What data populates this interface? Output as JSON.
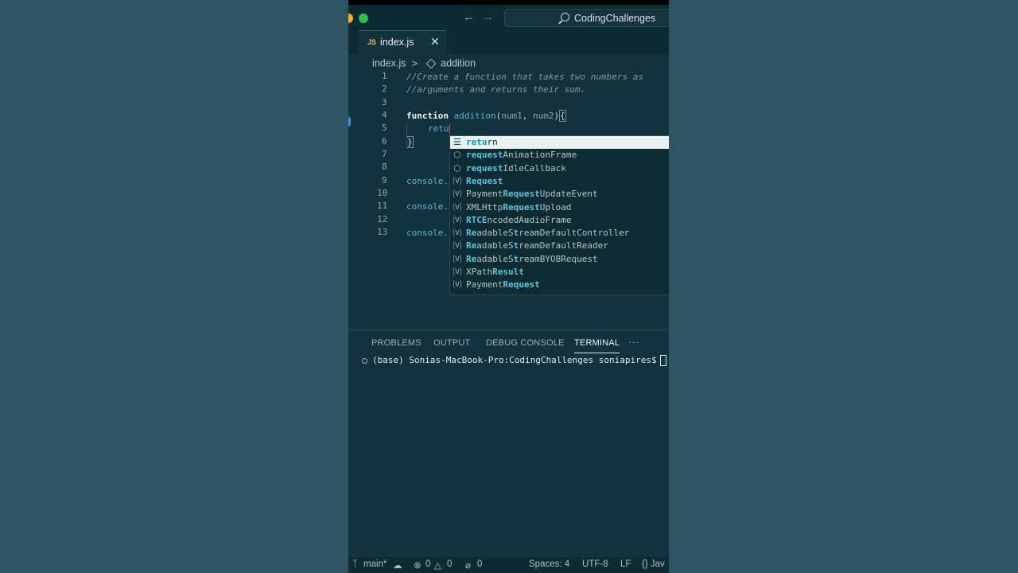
{
  "titlebar": {
    "back_icon": "arrow-left-icon",
    "forward_icon": "arrow-right-icon",
    "search_text": "CodingChallenges"
  },
  "tab": {
    "badge": "JS",
    "filename": "index.js"
  },
  "breadcrumb": {
    "file": "index.js",
    "separator": ">",
    "symbol": "addition"
  },
  "code": {
    "line_numbers": [
      "1",
      "2",
      "3",
      "4",
      "5",
      "6",
      "7",
      "8",
      "9",
      "10",
      "11",
      "12",
      "13"
    ],
    "line1": "//Create a function that takes two numbers as",
    "line2": "//arguments and returns their sum.",
    "line4_kw": "function",
    "line4_fn": "addition",
    "line4_open": "(",
    "line4_p1": "num1",
    "line4_comma": ", ",
    "line4_p2": "num2",
    "line4_close": ")",
    "line4_brace": "{",
    "line5": "retu",
    "line6": "}",
    "line9": "console.",
    "line11": "console.",
    "line13": "console."
  },
  "suggestions": [
    {
      "pre": "",
      "m1": "retu",
      "mid": "rn",
      "m2": "",
      "post": "",
      "icon": "keyword-icon"
    },
    {
      "pre": "",
      "m1": "re",
      "mid": "",
      "m2": "quest",
      "post": "AnimationFrame",
      "icon": "method-icon"
    },
    {
      "pre": "",
      "m1": "re",
      "mid": "",
      "m2": "quest",
      "post": "IdleCallback",
      "icon": "method-icon"
    },
    {
      "pre": "",
      "m1": "Re",
      "mid": "",
      "m2": "quest",
      "post": "",
      "icon": "variable-icon"
    },
    {
      "pre": "Payment",
      "m1": "R",
      "mid": "",
      "m2": "equest",
      "post": "UpdateEvent",
      "icon": "variable-icon"
    },
    {
      "pre": "XMLHttp",
      "m1": "R",
      "mid": "",
      "m2": "equest",
      "post": "Upload",
      "icon": "variable-icon"
    },
    {
      "pre": "",
      "m1": "RTCE",
      "mid": "ncodedA",
      "m2": "u",
      "post": "dioFrame",
      "icon": "variable-icon"
    },
    {
      "pre": "",
      "m1": "Re",
      "mid": "adableS",
      "m2": "t",
      "post": "reamDefaultController",
      "icon": "variable-icon"
    },
    {
      "pre": "",
      "m1": "Re",
      "mid": "adableS",
      "m2": "t",
      "post": "reamDefaultReader",
      "icon": "variable-icon"
    },
    {
      "pre": "",
      "m1": "Re",
      "mid": "adableS",
      "m2": "t",
      "post": "reamBYOBRequest",
      "icon": "variable-icon"
    },
    {
      "pre": "XPath",
      "m1": "Re",
      "mid": "",
      "m2": "sult",
      "post": "",
      "icon": "variable-icon"
    },
    {
      "pre": "Payment",
      "m1": "Re",
      "mid": "",
      "m2": "quest",
      "post": "",
      "icon": "variable-icon"
    }
  ],
  "panel": {
    "tabs": [
      "PROBLEMS",
      "OUTPUT",
      "DEBUG CONSOLE",
      "TERMINAL"
    ],
    "more": "···",
    "terminal_line": "(base) Sonias-MacBook-Pro:CodingChallenges soniapires$"
  },
  "statusbar": {
    "branch": "main*",
    "errors": "0",
    "warnings": "0",
    "ports": "0",
    "spaces": "Spaces: 4",
    "encoding": "UTF-8",
    "eol": "LF",
    "language": "{} Jav"
  },
  "colors": {
    "background": "#2f5563",
    "editor": "#12323d",
    "accent": "#5fc6dc"
  }
}
